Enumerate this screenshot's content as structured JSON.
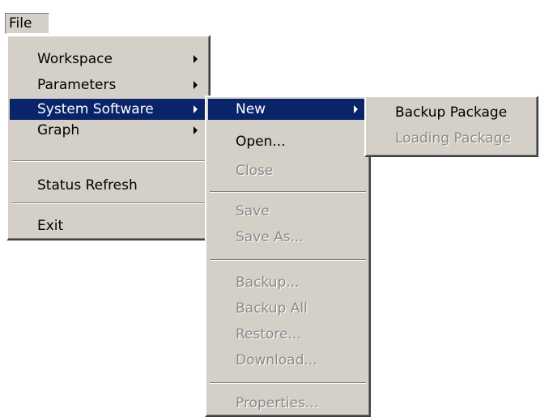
{
  "menubar": {
    "file_label": "File"
  },
  "file_menu": {
    "items": [
      {
        "label": "Workspace"
      },
      {
        "label": "Parameters"
      },
      {
        "label": "System Software"
      },
      {
        "label": "Graph"
      },
      {
        "label": "Status Refresh"
      },
      {
        "label": "Exit"
      }
    ]
  },
  "system_software_menu": {
    "items": [
      {
        "label": "New"
      },
      {
        "label": "Open..."
      },
      {
        "label": "Close"
      },
      {
        "label": "Save"
      },
      {
        "label": "Save As..."
      },
      {
        "label": "Backup..."
      },
      {
        "label": "Backup All"
      },
      {
        "label": "Restore..."
      },
      {
        "label": "Download..."
      },
      {
        "label": "Properties..."
      }
    ]
  },
  "new_menu": {
    "items": [
      {
        "label": "Backup Package"
      },
      {
        "label": "Loading Package"
      }
    ]
  },
  "colors": {
    "menu_background": "#d4d0c8",
    "selection": "#0a246a",
    "disabled_text": "#8a8a8a"
  }
}
